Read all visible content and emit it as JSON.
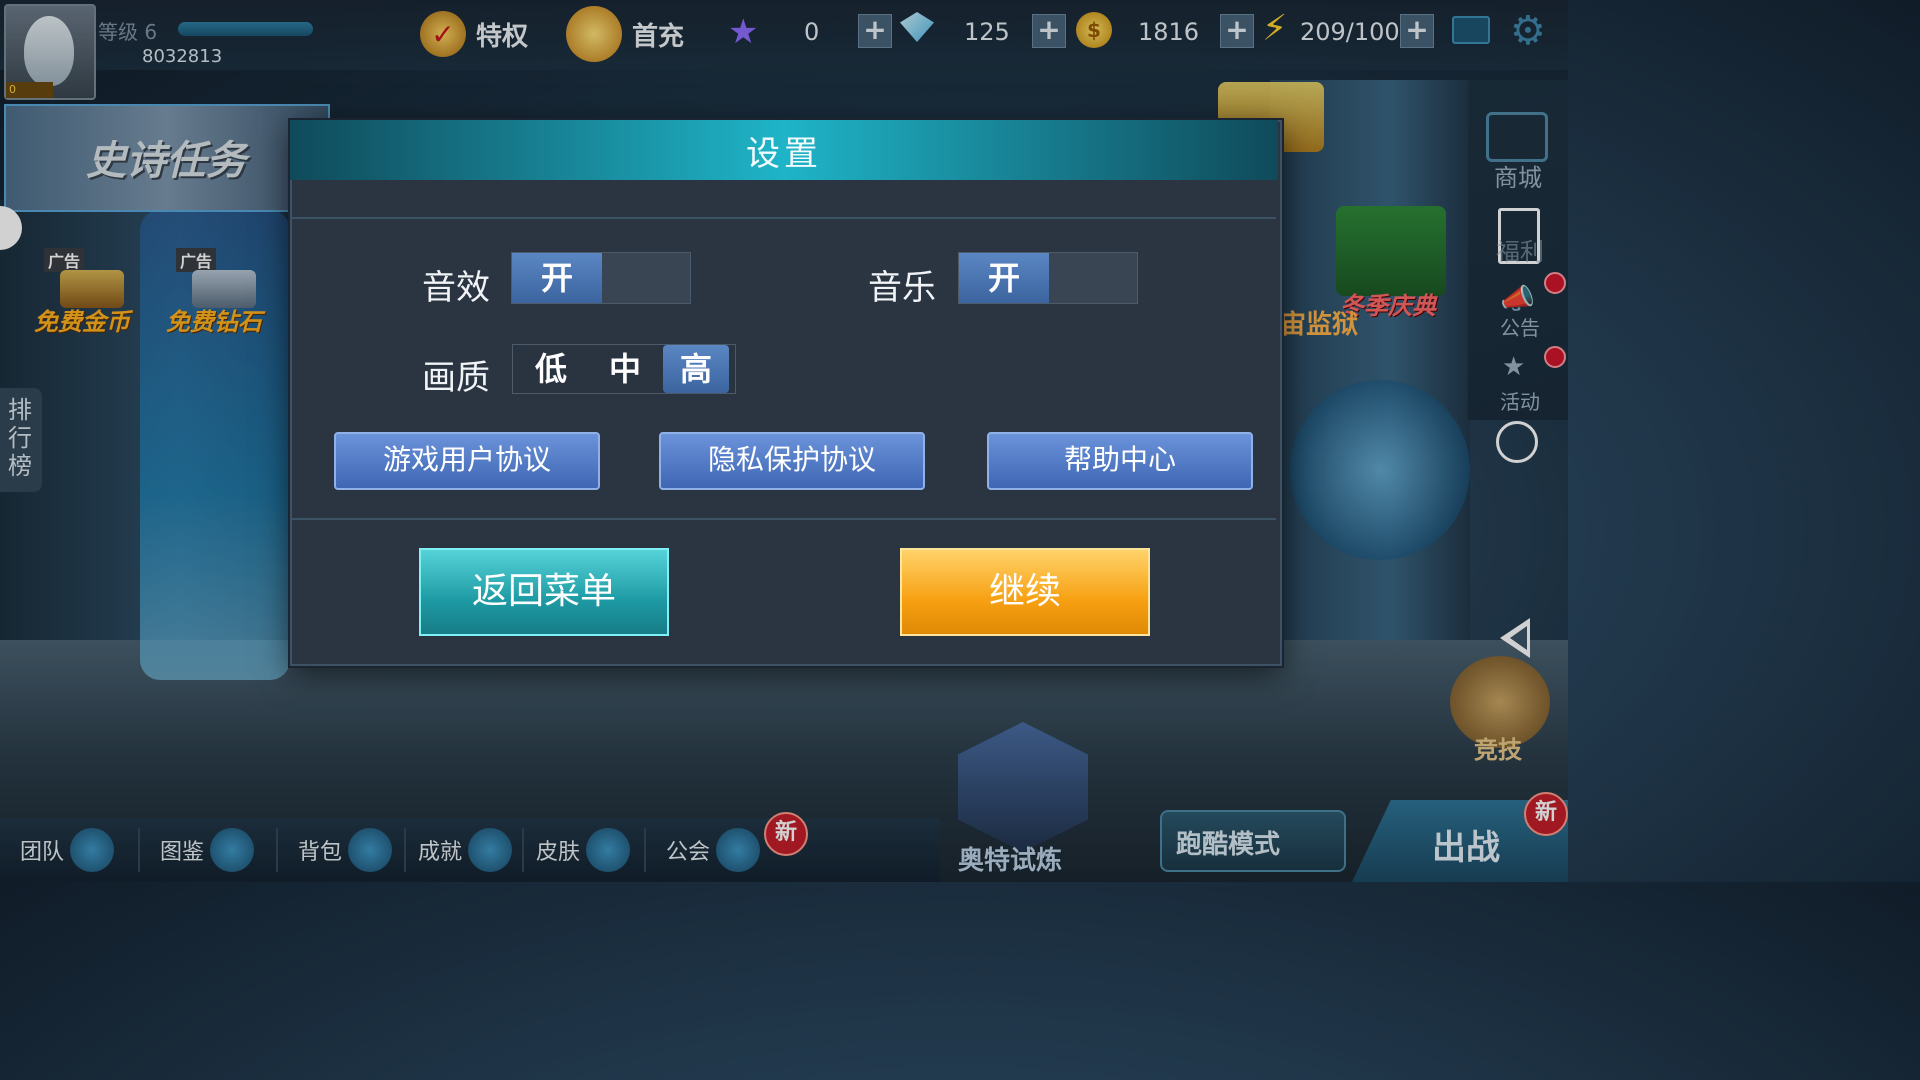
{
  "header": {
    "level_label": "等级 6",
    "user_id": "8032813",
    "avatar_badge": "0",
    "privilege_label": "特权",
    "first_recharge_label": "首充",
    "stars": "0",
    "diamonds": "125",
    "gold": "1816",
    "energy": "209/100",
    "plus_symbol": "+"
  },
  "left_panel": {
    "epic_quest_label": "史诗任务",
    "ad_tag": "广告",
    "free_gold_label": "免费金币",
    "free_diamond_label": "免费钻石",
    "leaderboard_label": "排行榜"
  },
  "right_panel": {
    "shop_label": "商城",
    "welfare_label": "福利",
    "notice_label": "公告",
    "activity_label": "活动",
    "winter_festival_label": "冬季庆典",
    "space_prison_label": "宙监狱",
    "arena_label": "竞技"
  },
  "bottom_nav": {
    "team": "团队",
    "codex": "图鉴",
    "bag": "背包",
    "achievement": "成就",
    "skin": "皮肤",
    "guild": "公会",
    "new_badge": "新",
    "ultra_trial": "奥特试炼",
    "parkour_mode": "跑酷模式",
    "battle": "出战"
  },
  "settings_dialog": {
    "title": "设置",
    "sound_effects_label": "音效",
    "sound_effects_state": "开",
    "music_label": "音乐",
    "music_state": "开",
    "quality_label": "画质",
    "quality_options": [
      "低",
      "中",
      "高"
    ],
    "quality_selected": "高",
    "user_agreement_button": "游戏用户协议",
    "privacy_button": "隐私保护协议",
    "help_button": "帮助中心",
    "back_to_menu_button": "返回菜单",
    "continue_button": "继续"
  },
  "colors": {
    "dialog_header": "#1fb4c8",
    "toggle_on": "#4a76b1",
    "link_button": "#4f78c6",
    "back_button": "#1e9aa4",
    "continue_button": "#f7a012"
  }
}
